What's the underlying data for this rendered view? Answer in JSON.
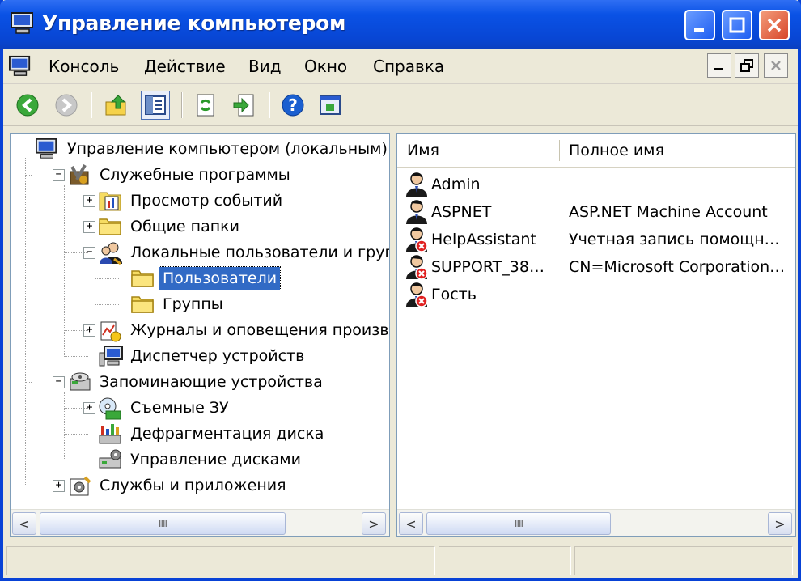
{
  "window": {
    "title": "Управление компьютером",
    "controls": {
      "minimize": "minimize",
      "maximize": "maximize",
      "close": "close"
    }
  },
  "menu": {
    "items": [
      "Консоль",
      "Действие",
      "Вид",
      "Окно",
      "Справка"
    ]
  },
  "toolbar": {
    "buttons": [
      "back-arrow-icon",
      "forward-arrow-icon",
      "up-folder-icon",
      "show-hide-tree-icon",
      "refresh-icon",
      "export-list-icon",
      "help-icon",
      "properties-icon"
    ]
  },
  "tree": {
    "nodes": [
      {
        "label": "Управление компьютером (локальным)",
        "level": 0,
        "expander": "",
        "icon": "computer-management-icon"
      },
      {
        "label": "Служебные программы",
        "level": 1,
        "expander": "−",
        "icon": "system-tools-icon"
      },
      {
        "label": "Просмотр событий",
        "level": 2,
        "expander": "+",
        "icon": "event-viewer-icon"
      },
      {
        "label": "Общие папки",
        "level": 2,
        "expander": "+",
        "icon": "shared-folders-icon"
      },
      {
        "label": "Локальные пользователи и групп",
        "level": 2,
        "expander": "−",
        "icon": "local-users-groups-icon"
      },
      {
        "label": "Пользователи",
        "level": 3,
        "expander": "",
        "icon": "users-folder-icon",
        "selected": true
      },
      {
        "label": "Группы",
        "level": 3,
        "expander": "",
        "icon": "groups-folder-icon"
      },
      {
        "label": "Журналы и оповещения произво,",
        "level": 2,
        "expander": "+",
        "icon": "performance-logs-icon"
      },
      {
        "label": "Диспетчер устройств",
        "level": 2,
        "expander": "",
        "icon": "device-manager-icon"
      },
      {
        "label": "Запоминающие устройства",
        "level": 1,
        "expander": "−",
        "icon": "storage-icon"
      },
      {
        "label": "Съемные ЗУ",
        "level": 2,
        "expander": "+",
        "icon": "removable-storage-icon"
      },
      {
        "label": "Дефрагментация диска",
        "level": 2,
        "expander": "",
        "icon": "disk-defrag-icon"
      },
      {
        "label": "Управление дисками",
        "level": 2,
        "expander": "",
        "icon": "disk-management-icon"
      },
      {
        "label": "Службы и приложения",
        "level": 1,
        "expander": "+",
        "icon": "services-apps-icon"
      }
    ]
  },
  "list": {
    "columns": [
      "Имя",
      "Полное имя"
    ],
    "rows": [
      {
        "name": "Admin",
        "full_name": "",
        "disabled": false
      },
      {
        "name": "ASPNET",
        "full_name": "ASP.NET Machine Account",
        "disabled": false
      },
      {
        "name": "HelpAssistant",
        "full_name": "Учетная запись помощн…",
        "disabled": true
      },
      {
        "name": "SUPPORT_38…",
        "full_name": "CN=Microsoft Corporation…",
        "disabled": true
      },
      {
        "name": "Гость",
        "full_name": "",
        "disabled": true
      }
    ]
  },
  "scroll": {
    "left_thumb": "IIII",
    "right_thumb": "IIII",
    "left_arrow": "<",
    "right_arrow": ">"
  }
}
